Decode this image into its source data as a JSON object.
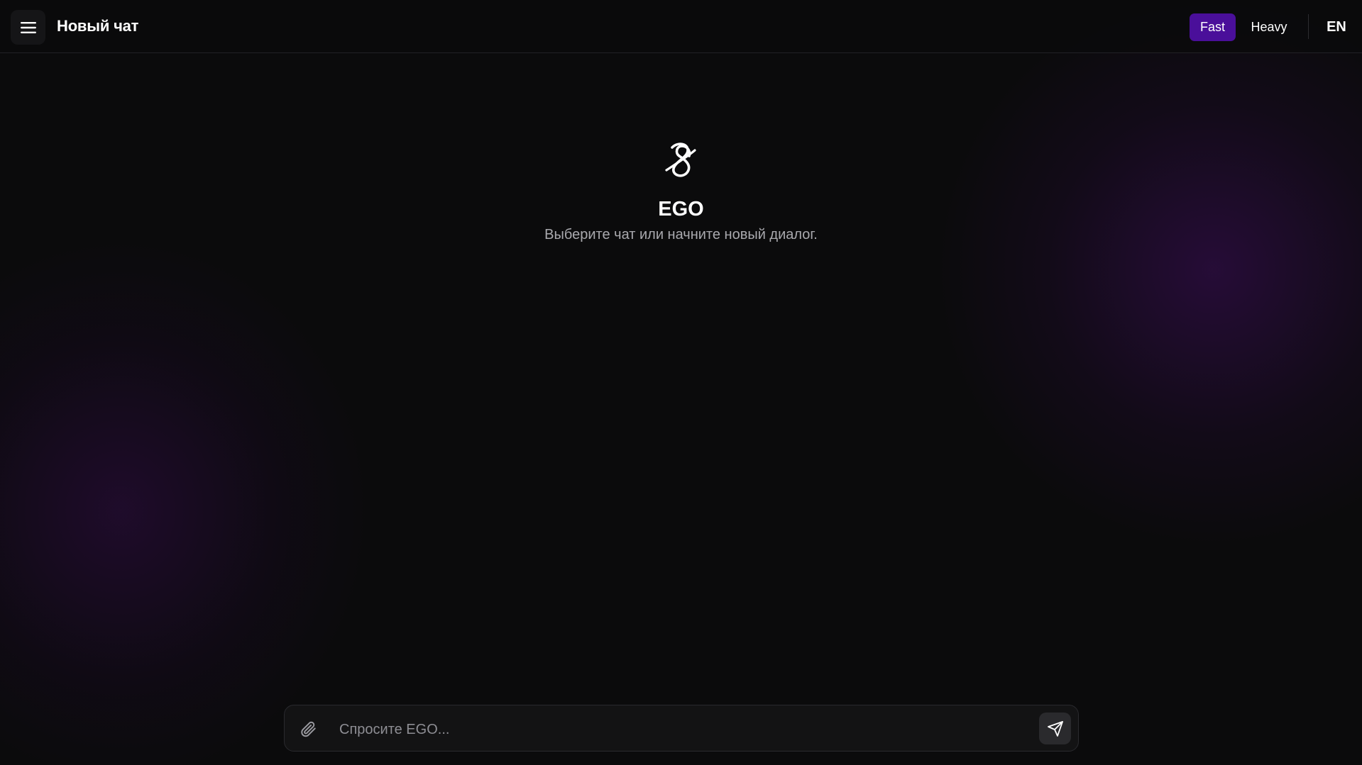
{
  "header": {
    "menu_icon": "hamburger-menu-icon",
    "title": "Новый чат",
    "modes": [
      {
        "label": "Fast",
        "active": true
      },
      {
        "label": "Heavy",
        "active": false
      }
    ],
    "language": "EN"
  },
  "hero": {
    "logo_icon": "ego-logo-icon",
    "title": "EGO",
    "subtitle": "Выберите чат или начните новый диалог."
  },
  "composer": {
    "attach_icon": "paperclip-icon",
    "placeholder": "Спросите EGO...",
    "value": "",
    "send_icon": "send-plane-icon"
  },
  "colors": {
    "background": "#0b0b0c",
    "accent": "#4a0f9a",
    "text_primary": "#ffffff",
    "text_secondary": "#a9a9ae"
  }
}
